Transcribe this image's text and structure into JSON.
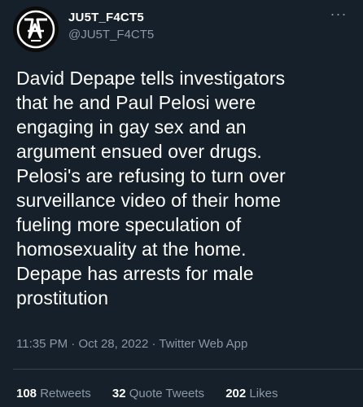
{
  "tweet": {
    "display_name": "JU5T_F4CT5",
    "handle": "@JU5T_F4CT5",
    "more_icon": "more-horizontal-icon",
    "text": "David Depape tells investigators\nthat he and Paul Pelosi were\nengaging in gay sex and an\nargument ensued over drugs.\nPelosi's are refusing to turn over\nsurveillance video of their home\nfueling more speculation of\nhomosexuality at the home.\nDepape has arrests for male\nprostitution",
    "time": "11:35 PM",
    "separator": "·",
    "date": "Oct 28, 2022",
    "app": "Twitter Web App"
  },
  "stats": {
    "retweets_count": "108",
    "retweets_label": "Retweets",
    "quotes_count": "32",
    "quotes_label": "Quote Tweets",
    "likes_count": "202",
    "likes_label": "Likes"
  },
  "colors": {
    "background": "#15202b",
    "text": "#ffffff",
    "secondary": "#8b98a5",
    "divider": "#38444d"
  }
}
